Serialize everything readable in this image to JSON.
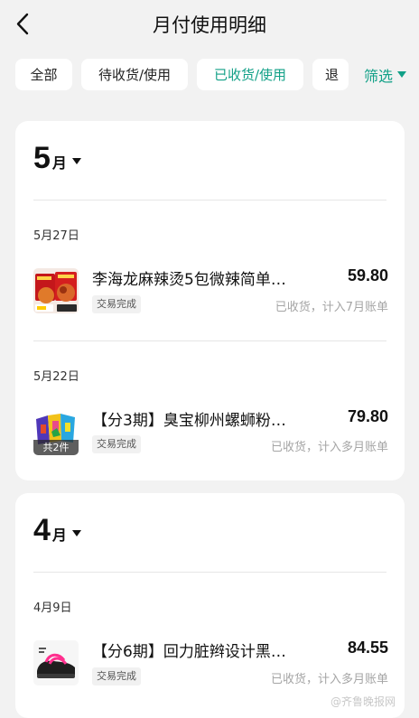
{
  "header": {
    "title": "月付使用明细"
  },
  "filters": {
    "tabs": [
      "全部",
      "待收货/使用",
      "已收货/使用",
      "退"
    ],
    "active_tab": "已收货/使用",
    "filter_label": "筛选"
  },
  "months": [
    {
      "month": "5",
      "unit": "月",
      "transactions": [
        {
          "date": "5月27日",
          "name": "李海龙麻辣烫5包微辣简单…",
          "amount": "59.80",
          "tag": "交易完成",
          "status": "已收货，计入7月账单"
        },
        {
          "date": "5月22日",
          "name": "【分3期】臭宝柳州螺蛳粉…",
          "amount": "79.80",
          "tag": "交易完成",
          "status": "已收货，计入多月账单",
          "thumb_badge": "共2件"
        }
      ]
    },
    {
      "month": "4",
      "unit": "月",
      "transactions": [
        {
          "date": "4月9日",
          "name": "【分6期】回力脏辫设计黑…",
          "amount": "84.55",
          "tag": "交易完成",
          "status": "已收货，计入多月账单"
        }
      ]
    }
  ],
  "watermark": "@齐鲁晚报网",
  "colors": {
    "accent": "#11a087",
    "background": "#f2f2f2",
    "card": "#ffffff"
  }
}
